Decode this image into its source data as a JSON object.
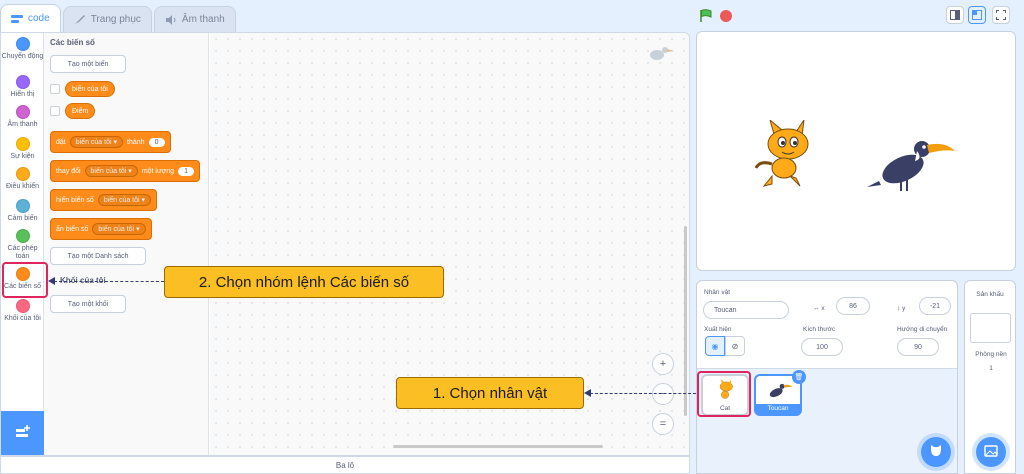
{
  "tabs": [
    {
      "label": "code",
      "icon": "code-icon",
      "active": true
    },
    {
      "label": "Trang phục",
      "icon": "brush-icon",
      "active": false
    },
    {
      "label": "Âm thanh",
      "icon": "speaker-icon",
      "active": false
    }
  ],
  "categories": [
    {
      "label": "Chuyển động",
      "color": "#4c97ff"
    },
    {
      "label": "Hiển thị",
      "color": "#9966ff"
    },
    {
      "label": "Âm thanh",
      "color": "#cf63cf"
    },
    {
      "label": "Sự kiện",
      "color": "#ffbf00"
    },
    {
      "label": "Điều khiển",
      "color": "#ffab19"
    },
    {
      "label": "Cảm biến",
      "color": "#5cb1d6"
    },
    {
      "label": "Các phép toán",
      "color": "#59c059"
    },
    {
      "label": "Các biến số",
      "color": "#ff8c1a"
    },
    {
      "label": "Khối của tôi",
      "color": "#ff6680"
    }
  ],
  "palette": {
    "heading": "Các biến số",
    "make_variable": "Tạo một biến",
    "var1": "biến của tôi",
    "var2": "Điểm",
    "set_block": {
      "verb": "đặt",
      "var": "biến của tôi",
      "to": "thành",
      "value": "0"
    },
    "change_block": {
      "verb": "thay đổi",
      "var": "biến của tôi",
      "by": "một lượng",
      "value": "1"
    },
    "show_block": {
      "verb": "hiển biến số",
      "var": "biến của tôi"
    },
    "hide_block": {
      "verb": "ẩn biến số",
      "var": "biến của tôi"
    },
    "make_list": "Tạo một Danh sách",
    "my_blocks_heading": "Khối của tôi",
    "make_block": "Tạo một khối"
  },
  "zoom": {
    "in": "+",
    "out": "−",
    "reset": "="
  },
  "backpack": "Ba lô",
  "sprite_info": {
    "sprite_label": "Nhân vật",
    "sprite_name": "Toucan",
    "x_label": "x",
    "x_value": "86",
    "y_label": "y",
    "y_value": "-21",
    "show_label": "Xuất hiện",
    "size_label": "Kích thước",
    "size_value": "100",
    "direction_label": "Hướng di chuyển",
    "direction_value": "90"
  },
  "sprites": [
    {
      "name": "Cat",
      "selected": false
    },
    {
      "name": "Toucan",
      "selected": true
    }
  ],
  "stage_pane": {
    "heading": "Sân khấu",
    "backdrops_label": "Phông nền",
    "backdrops_count": "1"
  },
  "annotations": {
    "step1": "1. Chọn nhân vật",
    "step2": "2. Chọn nhóm lệnh Các biến số",
    "highlight_color": "#e0245e",
    "callout_color": "#fbbf24"
  }
}
